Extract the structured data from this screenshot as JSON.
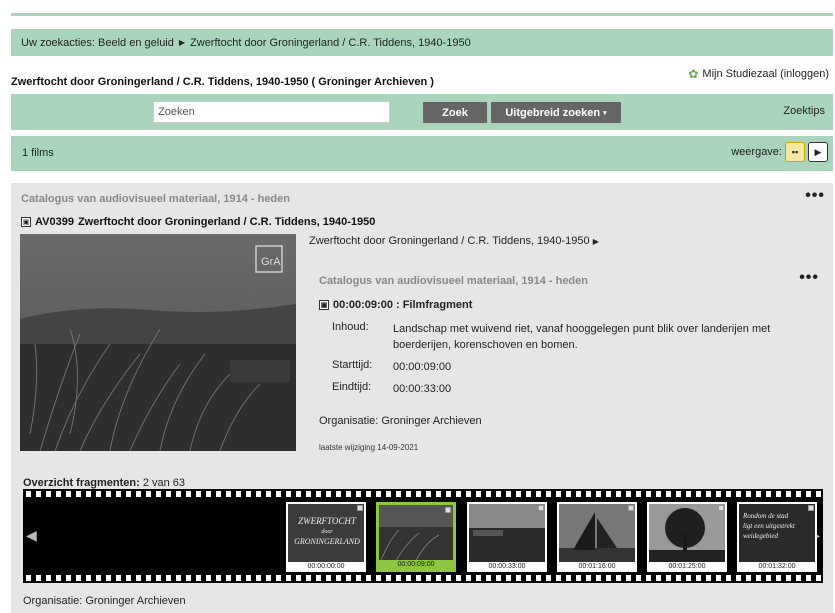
{
  "breadcrumb": {
    "root": "Uw zoekacties: Beeld en geluid",
    "current": "Zwerftocht door Groningerland / C.R. Tiddens, 1940-1950"
  },
  "page_title": "Zwerftocht door Groningerland / C.R. Tiddens, 1940-1950 ( Groninger Archieven )",
  "studiezaal_label": "Mijn Studiezaal (inloggen)",
  "search": {
    "placeholder": "Zoeken",
    "value": "",
    "zoek_label": "Zoek",
    "advanced_label": "Uitgebreid zoeken",
    "tips_label": "Zoektips"
  },
  "results": {
    "count_label": "1 films",
    "view_label": "weergave:"
  },
  "record": {
    "catalog": "Catalogus van audiovisueel materiaal, 1914 - heden",
    "code": "AV0399",
    "title": "Zwerftocht door Groningerland / C.R. Tiddens, 1940-1950",
    "video_watermark": "GrA",
    "related_link": "Zwerftocht door Groningerland / C.R. Tiddens, 1940-1950",
    "fragment": {
      "catalog": "Catalogus van audiovisueel materiaal, 1914 - heden",
      "title": "00:00:09:00 : Filmfragment",
      "inhoud_label": "Inhoud:",
      "inhoud": "Landschap met wuivend riet, vanaf hooggelegen punt blik over landerijen met boerderijen, korenschoven en bomen.",
      "start_label": "Starttijd:",
      "start": "00:00:09:00",
      "end_label": "Eindtijd:",
      "end": "00:00:33:00",
      "organisatie": "Organisatie: Groninger Archieven",
      "last_modified": "laatste wijziging 14-09-2021"
    },
    "overview_label": "Overzicht fragmenten:",
    "overview_value": "2 van 63",
    "thumbnails": [
      {
        "time": "00:00:00:00",
        "caption": "ZWERFTOCHT door GRONINGERLAND"
      },
      {
        "time": "00:00:09:00",
        "caption": ""
      },
      {
        "time": "00:00:33:00",
        "caption": ""
      },
      {
        "time": "00:01:16:00",
        "caption": ""
      },
      {
        "time": "00:01:25:00",
        "caption": ""
      },
      {
        "time": "00:01:32:00",
        "caption": "Rondom de stad ligt een uitgestrekt weidegebied"
      }
    ],
    "organisatie_bottom": "Organisatie: Groninger Archieven"
  },
  "colors": {
    "accent_green": "#a8d5bc",
    "button_gray": "#666666",
    "active_thumb": "#8dc63f"
  }
}
